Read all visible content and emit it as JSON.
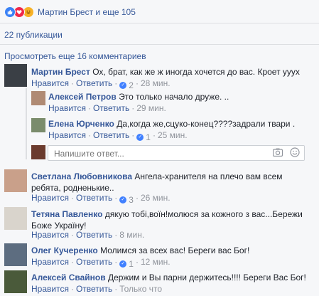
{
  "reactions": {
    "icons": [
      "like-icon",
      "love-icon",
      "haha-icon"
    ],
    "summary": "Мартин Брест и еще 105"
  },
  "shares": "22 публикации",
  "view_more": "Просмотреть еще 16 комментариев",
  "comments": [
    {
      "author": "Мартин Брест",
      "text": "Ох, брат, как же ж иногда хочется до вас. Кроет ууух",
      "like": "Нравится",
      "reply": "Ответить",
      "likes": "2",
      "time": "28 мин."
    },
    {
      "author": "Алексей Петров",
      "text": "Это только начало друже. ..",
      "like": "Нравится",
      "reply": "Ответить",
      "time": "29 мин."
    },
    {
      "author": "Елена Юрченко",
      "text": "Да,когда же,сцуко-конец????задрали твари .",
      "like": "Нравится",
      "reply": "Ответить",
      "likes": "1",
      "time": "25 мин."
    },
    {
      "author": "Светлана Любовникова",
      "text": "Ангела-хранителя на плечо вам всем ребята, родненькие..",
      "like": "Нравится",
      "reply": "Ответить",
      "likes": "3",
      "time": "26 мин."
    },
    {
      "author": "Тетяна Павленко",
      "text": "дякую тобі,воїн!молюся за кожного з вас...Бережи Боже Україну!",
      "like": "Нравится",
      "reply": "Ответить",
      "time": "8 мин."
    },
    {
      "author": "Олег Кучеренко",
      "text": "Молимся за всех вас! Береги вас Бог!",
      "like": "Нравится",
      "reply": "Ответить",
      "likes": "1",
      "time": "12 мин."
    },
    {
      "author": "Алексей Свайнов",
      "text": "Держим и Вы парни держитесь!!!! Береги Вас Бог!",
      "like": "Нравится",
      "reply": "Ответить",
      "time": "Только что"
    }
  ],
  "reply_box": {
    "placeholder": "Напишите ответ..."
  },
  "colors": {
    "link": "#365899",
    "meta": "#90949c",
    "background": "#f6f7f9",
    "like": "#4080ff"
  }
}
